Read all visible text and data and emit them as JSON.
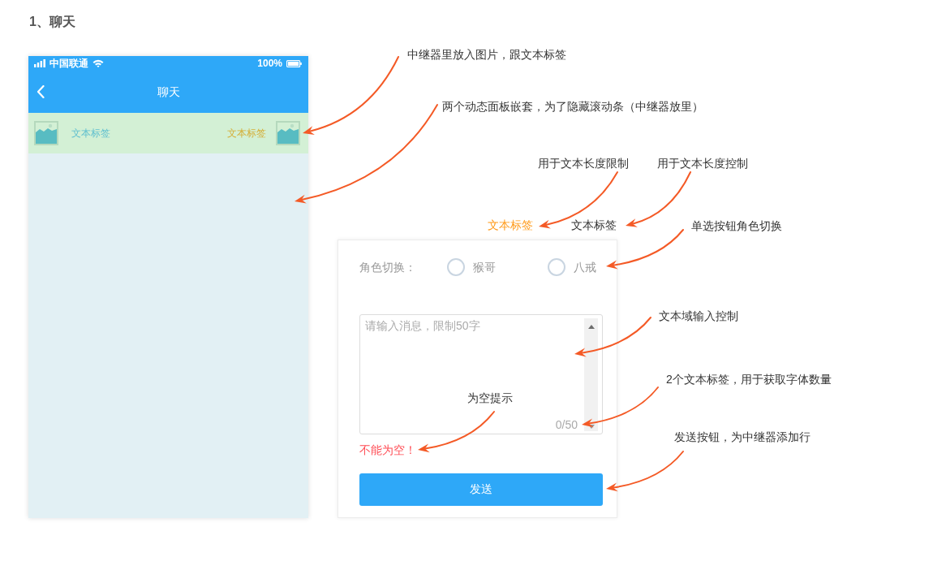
{
  "page_title": "1、聊天",
  "phone": {
    "status_bar": {
      "carrier": "中国联通",
      "battery": "100%"
    },
    "nav_bar": {
      "title": "聊天"
    },
    "chat_rows": [
      {
        "left_label": "文本标签",
        "right_label": "文本标签"
      }
    ]
  },
  "length_labels": [
    {
      "text": "文本标签",
      "color": "#ff9a1a"
    },
    {
      "text": "文本标签",
      "color": "#333333"
    }
  ],
  "form": {
    "role_switch": {
      "label": "角色切换：",
      "options": [
        {
          "label": "猴哥",
          "selected": false
        },
        {
          "label": "八戒",
          "selected": false
        }
      ]
    },
    "message_box": {
      "placeholder": "请输入消息，限制50字",
      "counter": "0/50"
    },
    "error_text": "不能为空！",
    "send_button": "发送"
  },
  "annotations": [
    {
      "text": "中继器里放入图片，跟文本标签"
    },
    {
      "text": "两个动态面板嵌套，为了隐藏滚动条（中继器放里）"
    },
    {
      "text": "用于文本长度限制"
    },
    {
      "text": "用于文本长度控制"
    },
    {
      "text": "单选按钮角色切换"
    },
    {
      "text": "文本域输入控制"
    },
    {
      "text": "2个文本标签，用于获取字体数量"
    },
    {
      "text": "为空提示"
    },
    {
      "text": "发送按钮，为中继器添加行"
    }
  ]
}
